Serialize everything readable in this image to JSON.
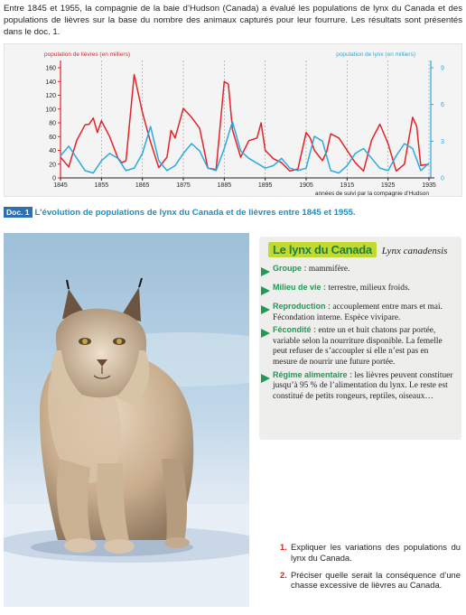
{
  "intro": "Entre 1845 et 1955, la compagnie de la baie d’Hudson (Canada) a évalué les populations de lynx du Canada et des populations de lièvres sur la base du nombre des animaux capturés pour leur fourrure. Les résultats sont présentés dans le doc. 1.",
  "chart_data": {
    "type": "line",
    "x_label": "années de suivi par la compagnie d’Hudson",
    "x_ticks": [
      1845,
      1855,
      1865,
      1875,
      1885,
      1895,
      1905,
      1915,
      1925,
      1935
    ],
    "xlim": [
      1845,
      1935
    ],
    "left_axis": {
      "label": "population de lièvres (en milliers)",
      "ticks": [
        0,
        20,
        40,
        60,
        80,
        100,
        120,
        140,
        160
      ],
      "ylim": [
        0,
        160
      ],
      "color": "#e32229"
    },
    "right_axis": {
      "label": "population de lynx (en milliers)",
      "ticks": [
        0,
        3,
        6,
        9
      ],
      "ylim": [
        0,
        9
      ],
      "color": "#29abe2"
    },
    "series": [
      {
        "name": "population de lièvres (en milliers)",
        "axis": "left",
        "color": "#e32229",
        "x": [
          1845,
          1847,
          1849,
          1851,
          1852,
          1853,
          1854,
          1855,
          1857,
          1859,
          1860,
          1861,
          1863,
          1865,
          1867,
          1869,
          1871,
          1872,
          1873,
          1875,
          1877,
          1879,
          1881,
          1883,
          1885,
          1886,
          1887,
          1889,
          1891,
          1893,
          1894,
          1895,
          1897,
          1899,
          1901,
          1903,
          1905,
          1906,
          1907,
          1909,
          1910,
          1911,
          1913,
          1915,
          1917,
          1919,
          1921,
          1923,
          1925,
          1927,
          1929,
          1931,
          1932,
          1933,
          1935
        ],
        "y": [
          30,
          16,
          55,
          77,
          78,
          87,
          66,
          83,
          60,
          29,
          22,
          25,
          150,
          95,
          52,
          15,
          30,
          69,
          58,
          101,
          88,
          72,
          14,
          12,
          140,
          136,
          70,
          30,
          54,
          58,
          80,
          40,
          28,
          22,
          10,
          13,
          66,
          58,
          40,
          25,
          38,
          64,
          58,
          40,
          22,
          10,
          55,
          78,
          50,
          10,
          20,
          88,
          75,
          18,
          20
        ]
      },
      {
        "name": "population de lynx (en milliers)",
        "axis": "right",
        "color": "#29abe2",
        "x": [
          1845,
          1847,
          1849,
          1851,
          1853,
          1855,
          1857,
          1859,
          1861,
          1863,
          1865,
          1867,
          1869,
          1871,
          1873,
          1875,
          1877,
          1879,
          1881,
          1883,
          1885,
          1887,
          1889,
          1891,
          1893,
          1895,
          1897,
          1899,
          1901,
          1903,
          1905,
          1907,
          1909,
          1911,
          1913,
          1915,
          1917,
          1919,
          1921,
          1923,
          1925,
          1927,
          1929,
          1931,
          1933,
          1935
        ],
        "y": [
          1.8,
          2.6,
          1.6,
          0.6,
          0.4,
          1.4,
          2.0,
          1.6,
          0.6,
          0.8,
          2.0,
          4.2,
          1.4,
          0.6,
          1.0,
          2.0,
          2.8,
          2.2,
          0.8,
          0.6,
          2.4,
          4.6,
          2.2,
          1.6,
          1.2,
          0.8,
          1.0,
          1.6,
          0.8,
          0.6,
          0.8,
          3.4,
          3.0,
          0.6,
          0.4,
          1.0,
          2.0,
          2.4,
          1.6,
          0.8,
          0.6,
          1.8,
          2.8,
          2.4,
          0.6,
          1.2
        ]
      }
    ]
  },
  "caption": {
    "badge": "Doc. 1",
    "text": "L’évolution de populations de lynx du Canada et de lièvres entre 1845 et 1955."
  },
  "photo": {
    "subject": "lynx du Canada dans la neige"
  },
  "info": {
    "title": "Le lynx du Canada",
    "latin": "Lynx canadensis",
    "bullet_color": "#1e9a52",
    "items": [
      {
        "key": "Groupe :",
        "text": "mammifère."
      },
      {
        "key": "Milieu de vie :",
        "text": "terrestre, milieux froids."
      },
      {
        "key": "Reproduction :",
        "text": "accouplement entre mars et mai. Fécondation interne. Espèce vivipare."
      },
      {
        "key": "Fécondité :",
        "text": "entre un et huit chatons par portée, variable selon la nourriture disponible. La femelle peut refuser de s’accoupler si elle n’est pas en mesure de nourrir une future portée."
      },
      {
        "key": "Régime alimentaire :",
        "text": "les lièvres peuvent constituer jusqu’à 95 % de l’alimentation du lynx. Le reste est constitué de petits rongeurs, reptiles, oiseaux…"
      }
    ]
  },
  "questions": [
    {
      "num": "1.",
      "text": "Expliquer les variations des populations du lynx du Canada."
    },
    {
      "num": "2.",
      "text": "Préciser quelle serait la conséquence d’une chasse excessive de lièvres au Canada."
    }
  ]
}
